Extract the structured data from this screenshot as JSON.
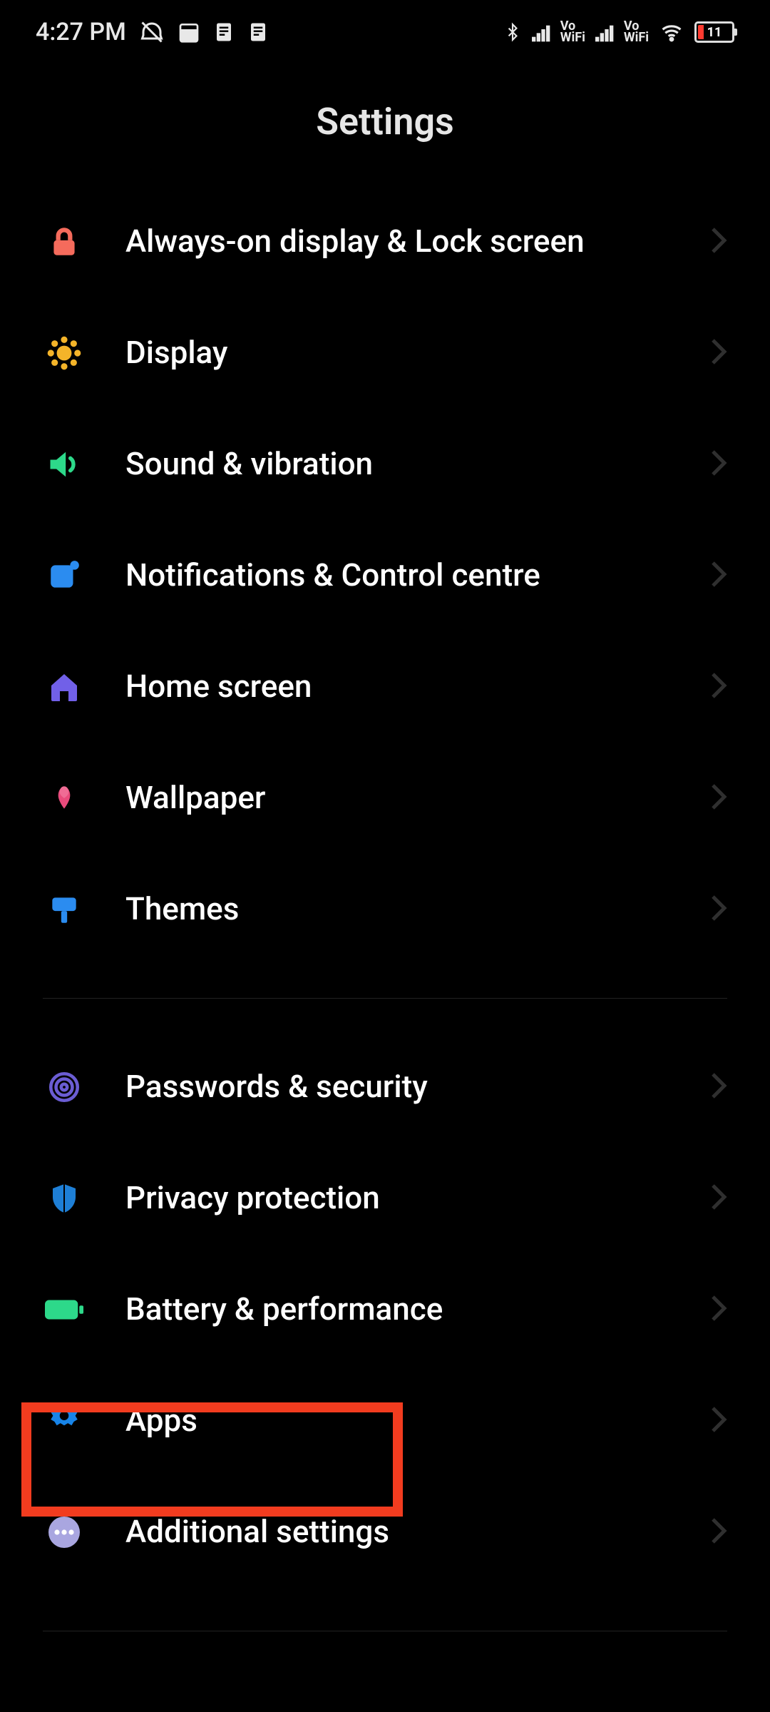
{
  "statusBar": {
    "time": "4:27 PM",
    "batteryPercent": "11"
  },
  "page": {
    "title": "Settings"
  },
  "items": [
    {
      "id": "lockscreen",
      "label": "Always-on display & Lock screen",
      "icon": "lock",
      "color": "#f56b5c"
    },
    {
      "id": "display",
      "label": "Display",
      "icon": "brightness",
      "color": "#f4b429"
    },
    {
      "id": "sound",
      "label": "Sound & vibration",
      "icon": "speaker",
      "color": "#2dd98a"
    },
    {
      "id": "notifications",
      "label": "Notifications & Control centre",
      "icon": "notification",
      "color": "#2b8cf0"
    },
    {
      "id": "home",
      "label": "Home screen",
      "icon": "home",
      "color": "#7160e8"
    },
    {
      "id": "wallpaper",
      "label": "Wallpaper",
      "icon": "flower",
      "color": "#e94b7c"
    },
    {
      "id": "themes",
      "label": "Themes",
      "icon": "brush",
      "color": "#2b8cf0"
    }
  ],
  "items2": [
    {
      "id": "security",
      "label": "Passwords & security",
      "icon": "fingerprint",
      "color": "#6b5dd3"
    },
    {
      "id": "privacy",
      "label": "Privacy protection",
      "icon": "shield",
      "color": "#1e7fd6"
    },
    {
      "id": "battery",
      "label": "Battery & performance",
      "icon": "battery",
      "color": "#2dd98a"
    },
    {
      "id": "apps",
      "label": "Apps",
      "icon": "gear",
      "color": "#1784e8",
      "highlighted": true
    },
    {
      "id": "additional",
      "label": "Additional settings",
      "icon": "dots",
      "color": "#a9a6e0"
    }
  ]
}
